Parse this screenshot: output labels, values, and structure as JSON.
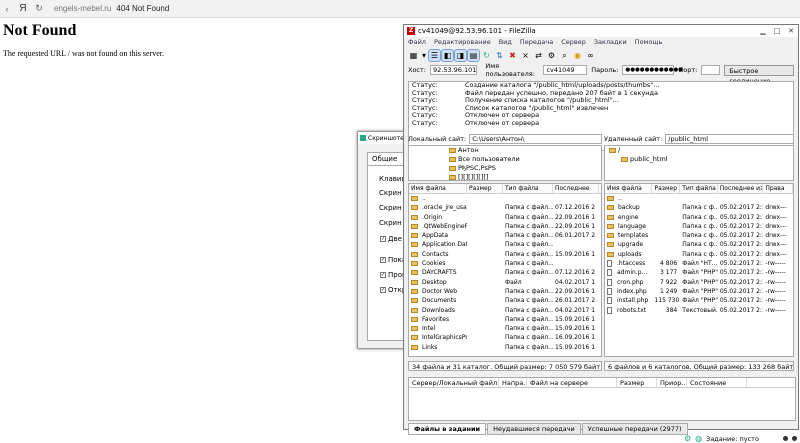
{
  "browser": {
    "host": "engels-mebel.ru",
    "page_title": "404 Not Found"
  },
  "page": {
    "heading": "Not Found",
    "message": "The requested URL / was not found on this server."
  },
  "screenshot_dialog": {
    "title": "Скриншоте",
    "tab": "Общие",
    "labels": [
      "Клавиш",
      "Скрин",
      "Скрин",
      "Скрин"
    ],
    "checks": [
      {
        "label": "Две с",
        "checked": true
      },
      {
        "label": "Пока",
        "checked": true
      },
      {
        "label": "Проиг",
        "checked": true
      },
      {
        "label": "Откр",
        "checked": true
      }
    ]
  },
  "filezilla": {
    "title": "cv41049@92.53.96.101 - FileZilla",
    "menu": [
      "Файл",
      "Редактирование",
      "Вид",
      "Передача",
      "Сервер",
      "Закладки",
      "Помощь"
    ],
    "quickconnect": {
      "host_label": "Хост:",
      "host": "92.53.96.101",
      "user_label": "Имя пользователя:",
      "user": "cv41049",
      "pass_label": "Пароль:",
      "pass": "●●●●●●●●●●●●",
      "port_label": "Порт:",
      "port": "",
      "button": "Быстрое соединение"
    },
    "log": [
      {
        "k": "Статус:",
        "v": "Создание каталога \"/public_html/uploads/posts/thumbs\"..."
      },
      {
        "k": "Статус:",
        "v": "Файл передан успешно, передано 207 байт в 1 секунда"
      },
      {
        "k": "Статус:",
        "v": "Получение списка каталогов \"/public_html\"..."
      },
      {
        "k": "Статус:",
        "v": "Список каталогов \"/public_html\" извлечен"
      },
      {
        "k": "Статус:",
        "v": "Отключен от сервера"
      },
      {
        "k": "Статус:",
        "v": "Отключен от сервера"
      }
    ],
    "local": {
      "path_label": "Локальный сайт:",
      "path": "C:\\Users\\Антон\\",
      "tree": [
        "Антон",
        "Все пользователи",
        "PђPSC,PsPS",
        "[][][][][][]"
      ],
      "headers": [
        "Имя файла",
        "Размер",
        "Тип файла",
        "Последнее"
      ],
      "files": [
        {
          "name": "..",
          "size": "",
          "type": "",
          "date": ""
        },
        {
          "name": ".oracle_jre_usage",
          "size": "",
          "type": "Папка с файл...",
          "date": "07.12.2016 2"
        },
        {
          "name": ".Origin",
          "size": "",
          "type": "Папка с файл...",
          "date": "22.09.2016 1"
        },
        {
          "name": ".QtWebEnginePr...",
          "size": "",
          "type": "Папка с файл...",
          "date": "22.09.2016 1"
        },
        {
          "name": "AppData",
          "size": "",
          "type": "Папка с файл...",
          "date": "06.01.2017 2"
        },
        {
          "name": "Application Data",
          "size": "",
          "type": "Папка с файл...",
          "date": ""
        },
        {
          "name": "Contacts",
          "size": "",
          "type": "Папка с файл...",
          "date": "15.09.2016 1"
        },
        {
          "name": "Cookies",
          "size": "",
          "type": "Папка с файл...",
          "date": ""
        },
        {
          "name": "DAYCRAFTS",
          "size": "",
          "type": "Папка с файл...",
          "date": "07.12.2016 2"
        },
        {
          "name": "Desktop",
          "size": "",
          "type": "Файл",
          "date": "04.02.2017 1"
        },
        {
          "name": "Doctor Web",
          "size": "",
          "type": "Папка с файл...",
          "date": "22.09.2016 1"
        },
        {
          "name": "Documents",
          "size": "",
          "type": "Папка с файл...",
          "date": "26.01.2017 2"
        },
        {
          "name": "Downloads",
          "size": "",
          "type": "Папка с файл...",
          "date": "04.02.2017 1"
        },
        {
          "name": "Favorites",
          "size": "",
          "type": "Папка с файл...",
          "date": "15.09.2016 1"
        },
        {
          "name": "Intel",
          "size": "",
          "type": "Папка с файл...",
          "date": "15.09.2016 1"
        },
        {
          "name": "IntelGraphicsPro...",
          "size": "",
          "type": "Папка с файл...",
          "date": "16.09.2016 1"
        },
        {
          "name": "Links",
          "size": "",
          "type": "Папка с файл...",
          "date": "15.09.2016 1"
        }
      ],
      "status": "34 файла и 31 каталог. Общий размер: 7 050 579 байт"
    },
    "remote": {
      "path_label": "Удаленный сайт:",
      "path": "/public_html",
      "tree": [
        "/",
        "public_html"
      ],
      "headers": [
        "Имя файла",
        "Размер",
        "Тип файла",
        "Последнее из",
        "Права"
      ],
      "files": [
        {
          "name": "..",
          "size": "",
          "type": "",
          "date": "",
          "perm": "",
          "dir": true
        },
        {
          "name": "backup",
          "size": "",
          "type": "Папка с ф...",
          "date": "05.02.2017 2:13...",
          "perm": "drwx---",
          "dir": true
        },
        {
          "name": "engine",
          "size": "",
          "type": "Папка с ф...",
          "date": "05.02.2017 2:13...",
          "perm": "drwx---",
          "dir": true
        },
        {
          "name": "language",
          "size": "",
          "type": "Папка с ф...",
          "date": "05.02.2017 2:13...",
          "perm": "drwx---",
          "dir": true
        },
        {
          "name": "templates",
          "size": "",
          "type": "Папка с ф...",
          "date": "05.02.2017 2:13...",
          "perm": "drwx---",
          "dir": true
        },
        {
          "name": "upgrade",
          "size": "",
          "type": "Папка с ф...",
          "date": "05.02.2017 2:13...",
          "perm": "drwx---",
          "dir": true
        },
        {
          "name": "uploads",
          "size": "",
          "type": "Папка с ф...",
          "date": "05.02.2017 2:13...",
          "perm": "drwx---",
          "dir": true
        },
        {
          "name": ".htaccess",
          "size": "4 806",
          "type": "Файл \"НТ...",
          "date": "05.02.2017 2:13...",
          "perm": "-rw-----",
          "dir": false
        },
        {
          "name": "admin.p...",
          "size": "3 177",
          "type": "Файл \"PHP\"",
          "date": "05.02.2017 2:13...",
          "perm": "-rw-----",
          "dir": false
        },
        {
          "name": "cron.php",
          "size": "7 922",
          "type": "Файл \"PHP\"",
          "date": "05.02.2017 2:13...",
          "perm": "-rw-----",
          "dir": false
        },
        {
          "name": "index.php",
          "size": "1 249",
          "type": "Файл \"PHP\"",
          "date": "05.02.2017 2:13...",
          "perm": "-rw-----",
          "dir": false
        },
        {
          "name": "install.php",
          "size": "115 730",
          "type": "Файл \"PHP\"",
          "date": "05.02.2017 2:13...",
          "perm": "-rw-----",
          "dir": false
        },
        {
          "name": "robots.txt",
          "size": "384",
          "type": "Текстовый...",
          "date": "05.02.2017 2:13...",
          "perm": "-rw-----",
          "dir": false
        }
      ],
      "status": "6 файлов и 6 каталогов. Общий размер: 133 268 байт"
    },
    "queue": {
      "headers": [
        "Сервер/Локальный файл",
        "Напра...",
        "Файл на сервере",
        "Размер",
        "Приор...",
        "Состояние"
      ],
      "tabs": [
        "Файлы в задании",
        "Неудавшиеся передачи",
        "Успешные передачи (2977)"
      ],
      "status": "Задание: пусто"
    }
  }
}
